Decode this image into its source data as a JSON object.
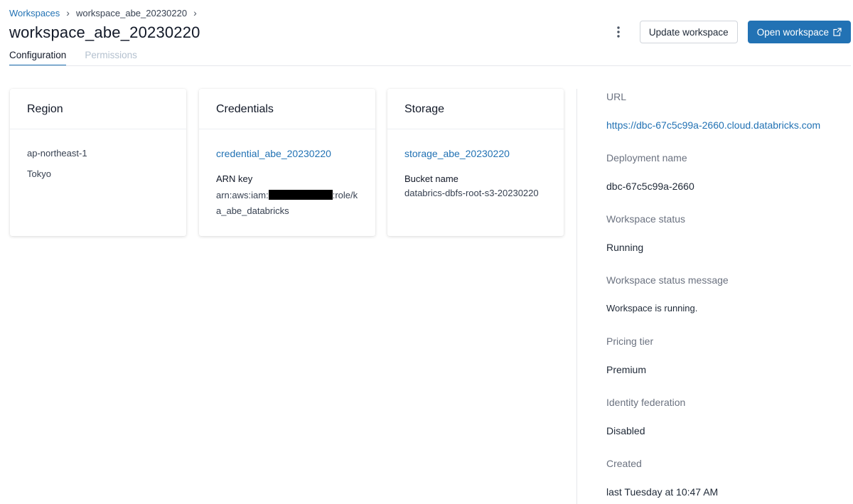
{
  "breadcrumb": {
    "items": [
      "Workspaces",
      "workspace_abe_20230220"
    ],
    "separator": "›"
  },
  "page": {
    "title": "workspace_abe_20230220"
  },
  "actions": {
    "update_label": "Update workspace",
    "open_label": "Open workspace",
    "more_icon": "kebab-icon",
    "open_icon": "external-link-icon"
  },
  "tabs": [
    {
      "label": "Configuration",
      "active": true
    },
    {
      "label": "Permissions",
      "active": false
    }
  ],
  "cards": {
    "region": {
      "title": "Region",
      "code": "ap-northeast-1",
      "city": "Tokyo"
    },
    "credentials": {
      "title": "Credentials",
      "link": "credential_abe_20230220",
      "arn_label": "ARN key",
      "arn_prefix": "arn:aws:iam:",
      "arn_suffix": ":role/ka_abe_databricks"
    },
    "storage": {
      "title": "Storage",
      "link": "storage_abe_20230220",
      "bucket_label": "Bucket name",
      "bucket_value": "databrics-dbfs-root-s3-20230220"
    }
  },
  "details": {
    "url_label": "URL",
    "url_value": "https://dbc-67c5c99a-2660.cloud.databricks.com",
    "deployment_label": "Deployment name",
    "deployment_value": "dbc-67c5c99a-2660",
    "status_label": "Workspace status",
    "status_value": "Running",
    "status_msg_label": "Workspace status message",
    "status_msg_value": "Workspace is running.",
    "pricing_label": "Pricing tier",
    "pricing_value": "Premium",
    "identity_label": "Identity federation",
    "identity_value": "Disabled",
    "created_label": "Created",
    "created_value": "last Tuesday at 10:47 AM"
  },
  "colors": {
    "accent": "#2272b4",
    "muted_tab": "#b4c1cf",
    "redaction": "#000000"
  }
}
